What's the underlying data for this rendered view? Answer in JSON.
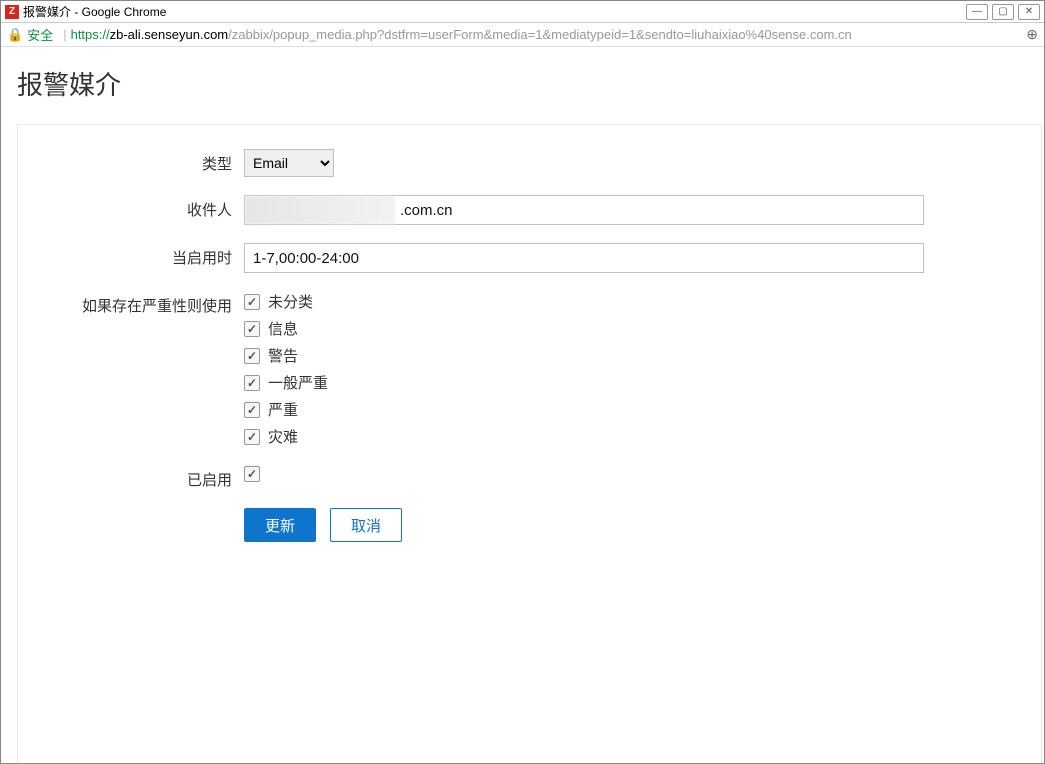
{
  "window": {
    "title": "报警媒介 - Google Chrome",
    "favicon_letter": "Z"
  },
  "addressbar": {
    "secure_label": "安全",
    "url_https": "https://",
    "url_domain": "zb-ali.senseyun.com",
    "url_path": "/zabbix/popup_media.php?dstfrm=userForm&media=1&mediatypeid=1&sendto=liuhaixiao%40sense.com.cn"
  },
  "page": {
    "title": "报警媒介"
  },
  "form": {
    "type_label": "类型",
    "type_value": "Email",
    "recipient_label": "收件人",
    "recipient_value": ".com.cn",
    "when_label": "当启用时",
    "when_value": "1-7,00:00-24:00",
    "severity_label": "如果存在严重性则使用",
    "severity_items": [
      {
        "label": "未分类",
        "checked": true
      },
      {
        "label": "信息",
        "checked": true
      },
      {
        "label": "警告",
        "checked": true
      },
      {
        "label": "一般严重",
        "checked": true
      },
      {
        "label": "严重",
        "checked": true
      },
      {
        "label": "灾难",
        "checked": true
      }
    ],
    "enabled_label": "已启用",
    "enabled_checked": true,
    "update_button": "更新",
    "cancel_button": "取消"
  }
}
